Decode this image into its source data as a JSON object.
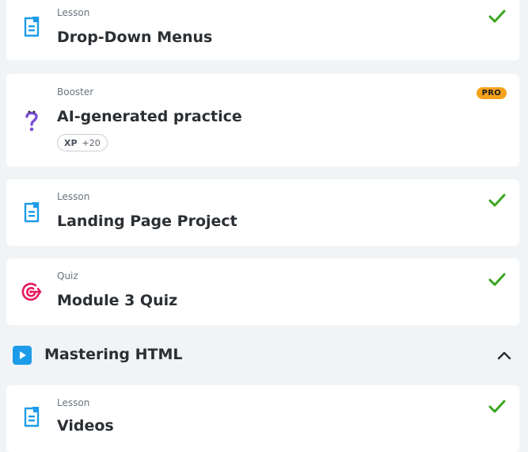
{
  "items": [
    {
      "kind": "Lesson",
      "title": "Drop-Down Menus",
      "icon": "lesson-icon",
      "completed": true
    },
    {
      "kind": "Booster",
      "title": "AI-generated practice",
      "icon": "question-icon",
      "badge": "PRO",
      "xp_label": "XP",
      "xp_value": "+20"
    },
    {
      "kind": "Lesson",
      "title": "Landing Page Project",
      "icon": "lesson-icon",
      "completed": true
    },
    {
      "kind": "Quiz",
      "title": "Module 3 Quiz",
      "icon": "target-icon",
      "completed": true
    }
  ],
  "section": {
    "title": "Mastering HTML",
    "icon": "play-icon",
    "expanded": true
  },
  "section_items": [
    {
      "kind": "Lesson",
      "title": "Videos",
      "icon": "lesson-icon",
      "completed": true
    }
  ],
  "colors": {
    "accent_blue": "#1c9ce8",
    "check_green": "#3aa620",
    "pro_orange": "#f7a21b",
    "quiz_red": "#e5195f",
    "booster_purple": "#7a4fd6"
  }
}
